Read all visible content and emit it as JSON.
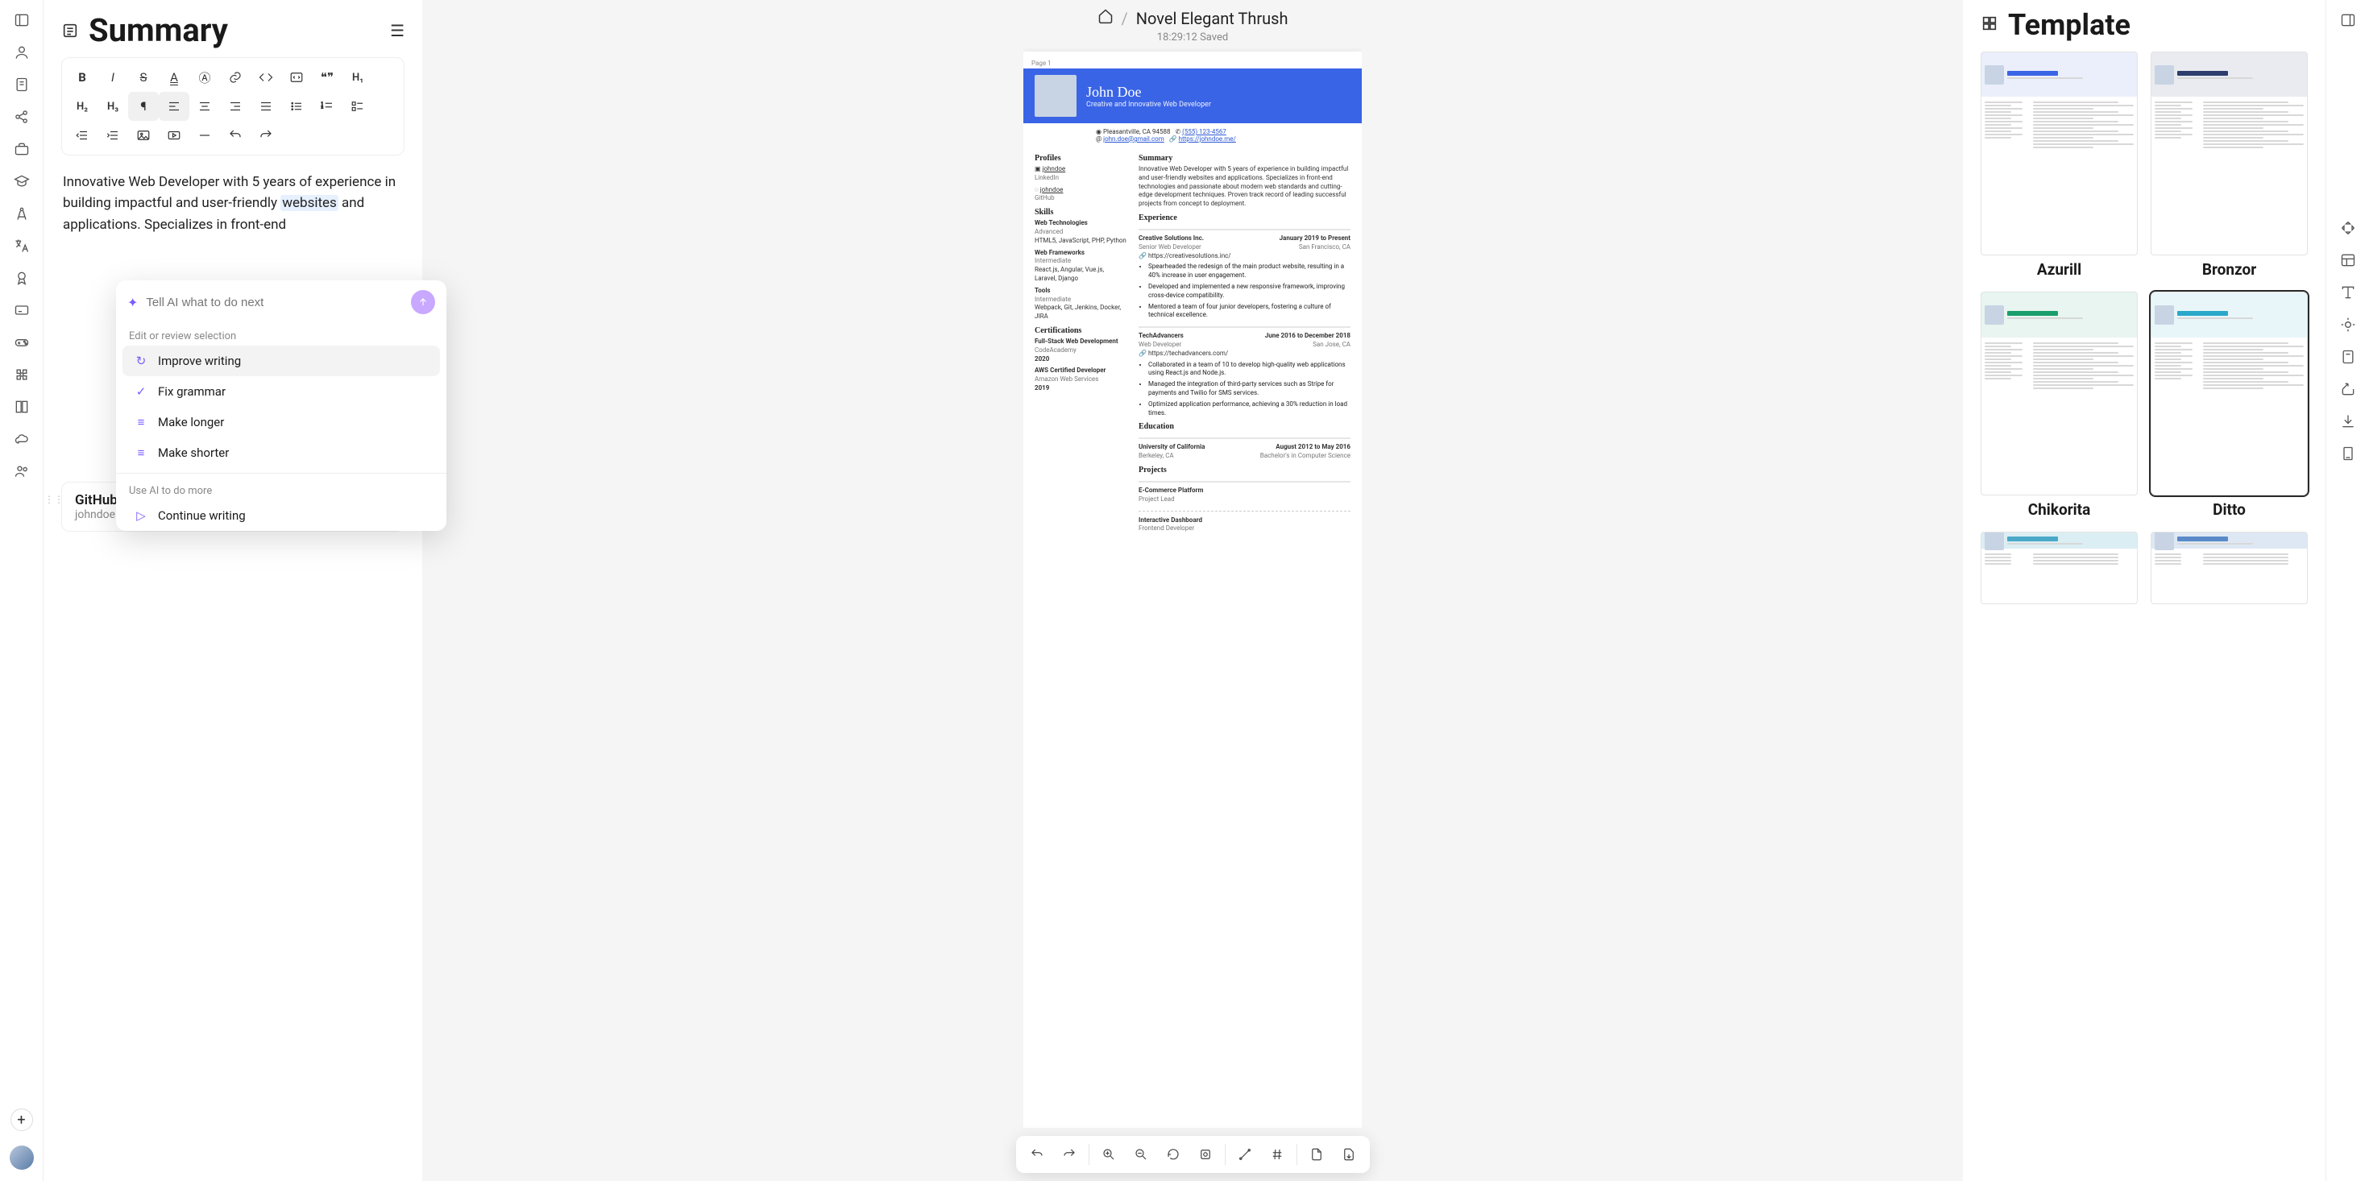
{
  "left_rail": {
    "icons": [
      "panel-left",
      "user",
      "note",
      "share",
      "briefcase",
      "graduation",
      "compass",
      "translate",
      "award",
      "card",
      "gamepad",
      "puzzle",
      "book",
      "cloud",
      "users"
    ]
  },
  "summary": {
    "title": "Summary",
    "editor_text_1": "Innovative Web Developer with 5 years of experience in building impactful and user-friendly ",
    "editor_hl": "websites",
    "editor_text_2": " and applications. Specializes in front-end"
  },
  "ai": {
    "placeholder": "Tell AI what to do next",
    "edit_label": "Edit or review selection",
    "items": [
      "Improve writing",
      "Fix grammar",
      "Make longer",
      "Make shorter"
    ],
    "use_label": "Use AI to do more",
    "continue": "Continue writing"
  },
  "github_card": {
    "title": "GitHub",
    "sub": "johndoe"
  },
  "doc": {
    "breadcrumb_title": "Novel Elegant Thrush",
    "saved": "18:29:12 Saved",
    "page_label": "Page 1"
  },
  "resume": {
    "name": "John Doe",
    "tagline": "Creative and Innovative Web Developer",
    "location": "Pleasantville, CA 94588",
    "phone": "(555) 123-4567",
    "email": "john.doe@gmail.com",
    "site": "https://johndoe.me/",
    "profiles_h": "Profiles",
    "profiles": [
      {
        "handle": "johndoe",
        "net": "LinkedIn"
      },
      {
        "handle": "johndoe",
        "net": "GitHub"
      }
    ],
    "skills_h": "Skills",
    "skills": [
      {
        "name": "Web Technologies",
        "level": "Advanced",
        "list": "HTML5, JavaScript, PHP, Python"
      },
      {
        "name": "Web Frameworks",
        "level": "Intermediate",
        "list": "React.js, Angular, Vue.js, Laravel, Django"
      },
      {
        "name": "Tools",
        "level": "Intermediate",
        "list": "Webpack, Git, Jenkins, Docker, JIRA"
      }
    ],
    "cert_h": "Certifications",
    "certs": [
      {
        "name": "Full-Stack Web Development",
        "org": "CodeAcademy",
        "year": "2020"
      },
      {
        "name": "AWS Certified Developer",
        "org": "Amazon Web Services",
        "year": "2019"
      }
    ],
    "summary_h": "Summary",
    "summary_text": "Innovative Web Developer with 5 years of experience in building impactful and user-friendly websites and applications. Specializes in front-end technologies and passionate about modern web standards and cutting-edge development techniques. Proven track record of leading successful projects from concept to deployment.",
    "exp_h": "Experience",
    "exp": [
      {
        "company": "Creative Solutions Inc.",
        "role": "Senior Web Developer",
        "dates": "January 2019 to Present",
        "loc": "San Francisco, CA",
        "url": "https://creativesolutions.inc/",
        "bullets": [
          "Spearheaded the redesign of the main product website, resulting in a 40% increase in user engagement.",
          "Developed and implemented a new responsive framework, improving cross-device compatibility.",
          "Mentored a team of four junior developers, fostering a culture of technical excellence."
        ]
      },
      {
        "company": "TechAdvancers",
        "role": "Web Developer",
        "dates": "June 2016 to December 2018",
        "loc": "San Jose, CA",
        "url": "https://techadvancers.com/",
        "bullets": [
          "Collaborated in a team of 10 to develop high-quality web applications using React.js and Node.js.",
          "Managed the integration of third-party services such as Stripe for payments and Twilio for SMS services.",
          "Optimized application performance, achieving a 30% reduction in load times."
        ]
      }
    ],
    "edu_h": "Education",
    "edu": {
      "school": "University of California",
      "loc": "Berkeley, CA",
      "dates": "August 2012 to May 2016",
      "degree": "Bachelor's in Computer Science"
    },
    "proj_h": "Projects",
    "projects": [
      {
        "name": "E-Commerce Platform",
        "role": "Project Lead"
      },
      {
        "name": "Interactive Dashboard",
        "role": "Frontend Developer"
      }
    ]
  },
  "templates": {
    "title": "Template",
    "items": [
      {
        "name": "Azurill",
        "accent": "#3a64e6",
        "selected": false
      },
      {
        "name": "Bronzor",
        "accent": "#2d3e6e",
        "selected": false
      },
      {
        "name": "Chikorita",
        "accent": "#1a9e6b",
        "selected": false
      },
      {
        "name": "Ditto",
        "accent": "#2aa8c9",
        "selected": true
      }
    ]
  }
}
